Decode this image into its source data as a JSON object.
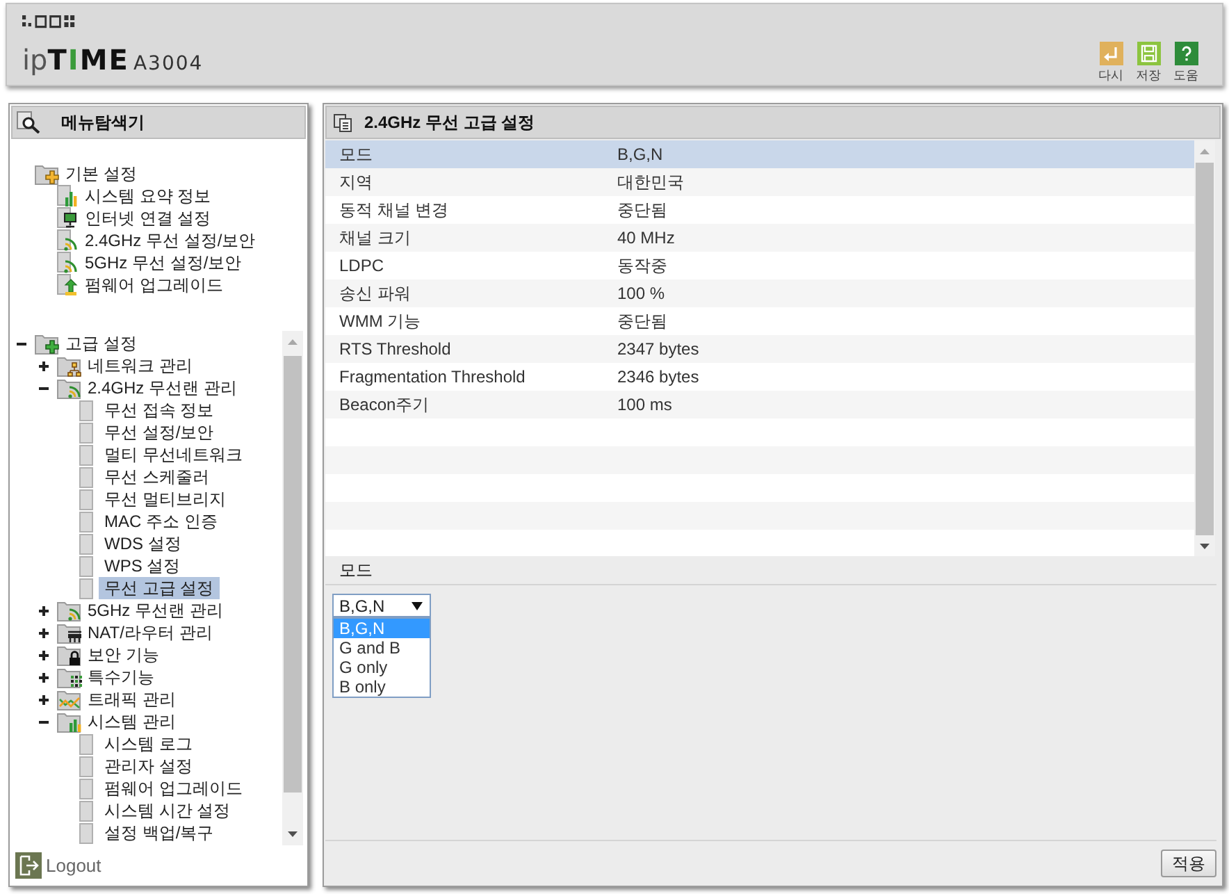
{
  "header": {
    "logo": "ipTIME",
    "model": "A3004",
    "actions": [
      {
        "kind": "undo",
        "label": "다시"
      },
      {
        "kind": "save",
        "label": "저장"
      },
      {
        "kind": "help",
        "label": "도움"
      }
    ]
  },
  "sidebar": {
    "title": "메뉴탐색기",
    "basic_menu": [
      {
        "label": "기본 설정",
        "kind": "basic",
        "selected": false,
        "children": [
          {
            "label": "시스템 요약 정보",
            "kind": "summary",
            "selected": false
          },
          {
            "label": "인터넷 연결 설정",
            "kind": "internet",
            "selected": false
          },
          {
            "label": "2.4GHz 무선 설정/보안",
            "kind": "wireless",
            "selected": false
          },
          {
            "label": "5GHz 무선 설정/보안",
            "kind": "wireless",
            "selected": false
          },
          {
            "label": "펌웨어 업그레이드",
            "kind": "firmware",
            "selected": false
          }
        ]
      }
    ],
    "advanced_menu": [
      {
        "label": "고급 설정",
        "kind": "advanced",
        "expanded": true,
        "selected": false,
        "children": [
          {
            "label": "네트워크 관리",
            "kind": "network",
            "expanded": false,
            "selected": false
          },
          {
            "label": "2.4GHz 무선랜 관리",
            "kind": "wlan",
            "expanded": true,
            "selected": false,
            "children": [
              {
                "label": "무선 접속 정보",
                "kind": "page",
                "selected": false
              },
              {
                "label": "무선 설정/보안",
                "kind": "page",
                "selected": false
              },
              {
                "label": "멀티 무선네트워크",
                "kind": "page",
                "selected": false
              },
              {
                "label": "무선 스케줄러",
                "kind": "page",
                "selected": false
              },
              {
                "label": "무선 멀티브리지",
                "kind": "page",
                "selected": false
              },
              {
                "label": "MAC 주소 인증",
                "kind": "page",
                "selected": false
              },
              {
                "label": "WDS 설정",
                "kind": "page",
                "selected": false
              },
              {
                "label": "WPS 설정",
                "kind": "page",
                "selected": false
              },
              {
                "label": "무선 고급 설정",
                "kind": "page",
                "selected": true
              }
            ]
          },
          {
            "label": "5GHz 무선랜 관리",
            "kind": "wlan",
            "expanded": false,
            "selected": false
          },
          {
            "label": "NAT/라우터 관리",
            "kind": "router",
            "expanded": false,
            "selected": false
          },
          {
            "label": "보안 기능",
            "kind": "security",
            "expanded": false,
            "selected": false
          },
          {
            "label": "특수기능",
            "kind": "special",
            "expanded": false,
            "selected": false
          },
          {
            "label": "트래픽 관리",
            "kind": "traffic",
            "expanded": false,
            "selected": false
          },
          {
            "label": "시스템 관리",
            "kind": "system",
            "expanded": true,
            "selected": false,
            "children": [
              {
                "label": "시스템 로그",
                "kind": "page",
                "selected": false
              },
              {
                "label": "관리자 설정",
                "kind": "page",
                "selected": false
              },
              {
                "label": "펌웨어 업그레이드",
                "kind": "page",
                "selected": false
              },
              {
                "label": "시스템 시간 설정",
                "kind": "page",
                "selected": false
              },
              {
                "label": "설정 백업/복구",
                "kind": "page",
                "selected": false
              }
            ]
          }
        ]
      }
    ],
    "logout": "Logout"
  },
  "content": {
    "title": "2.4GHz 무선 고급 설정",
    "rows": [
      {
        "label": "모드",
        "value": "B,G,N",
        "selected": true
      },
      {
        "label": "지역",
        "value": "대한민국",
        "selected": false
      },
      {
        "label": "동적 채널 변경",
        "value": "중단됨",
        "selected": false
      },
      {
        "label": "채널 크기",
        "value": "40 MHz",
        "selected": false
      },
      {
        "label": "LDPC",
        "value": "동작중",
        "selected": false
      },
      {
        "label": "송신 파워",
        "value": "100 %",
        "selected": false
      },
      {
        "label": "WMM 기능",
        "value": "중단됨",
        "selected": false
      },
      {
        "label": "RTS Threshold",
        "value": "2347 bytes",
        "selected": false
      },
      {
        "label": "Fragmentation Threshold",
        "value": "2346 bytes",
        "selected": false
      },
      {
        "label": "Beacon주기",
        "value": "100 ms",
        "selected": false
      }
    ],
    "detail": {
      "label": "모드",
      "value": "B,G,N",
      "expanded": true,
      "options": [
        {
          "label": "B,G,N",
          "selected": true
        },
        {
          "label": "G and B",
          "selected": false
        },
        {
          "label": "G only",
          "selected": false
        },
        {
          "label": "B only",
          "selected": false
        }
      ]
    },
    "apply_button": "적용"
  }
}
